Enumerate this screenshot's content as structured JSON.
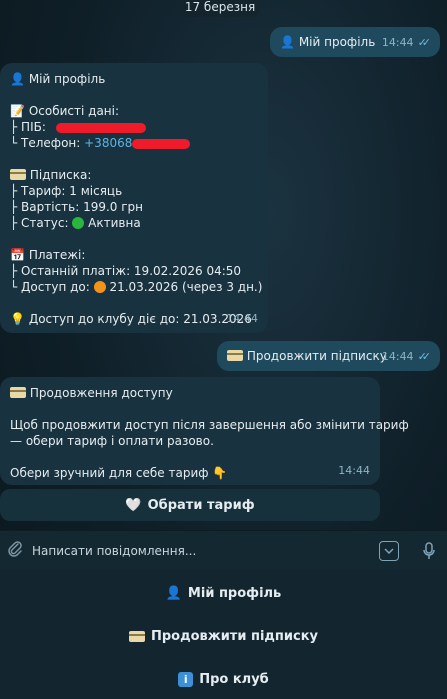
{
  "date_label": "17 березня",
  "messages": {
    "out1": {
      "text": "Мій профіль",
      "time": "14:44"
    },
    "profile": {
      "title": "Мій профіль",
      "personal_header": "Особисті дані:",
      "pib_label": "├ ПІБ:",
      "phone_label": "└ Телефон:",
      "phone_value": "+38068",
      "sub_header": "Підписка:",
      "tariff": "├ Тариф: 1 місяць",
      "price": "├ Вартість: 199.0 грн",
      "status_label": "├ Статус:",
      "status_value": "Активна",
      "payments_header": "Платежі:",
      "last_payment": "├ Останній платіж: 19.02.2026 04:50",
      "access_label": "└ Доступ до:",
      "access_value": "21.03.2026 (через 3 дн.)",
      "club_access": "Доступ до клубу діє до: 21.03.2026",
      "time": "14:44"
    },
    "out2": {
      "text": "Продовжити підписку",
      "time": "14:44"
    },
    "renew": {
      "title": "Продовження доступу",
      "body_line1": "Щоб продовжити доступ після завершення або змінити тариф",
      "body_line2": "— обери тариф і оплати разово.",
      "choose": "Обери зручний для себе тариф",
      "time": "14:44",
      "button": "Обрати тариф"
    }
  },
  "composer": {
    "placeholder": "Написати повідомлення..."
  },
  "keyboard": {
    "btn1": "Мій профіль",
    "btn2": "Продовжити підписку",
    "btn3": "Про клуб"
  },
  "colors": {
    "accent": "#5fb3e6",
    "bubble_in": "#18323f",
    "bubble_out": "#1f4a5d",
    "redaction": "#ee1c2b"
  },
  "icons": [
    "user-icon",
    "memo-icon",
    "credit-card-icon",
    "calendar-icon",
    "bulb-icon",
    "point-down-icon",
    "white-heart-icon",
    "info-icon",
    "paperclip-icon",
    "keyboard-icon",
    "mic-icon",
    "double-check-icon"
  ]
}
